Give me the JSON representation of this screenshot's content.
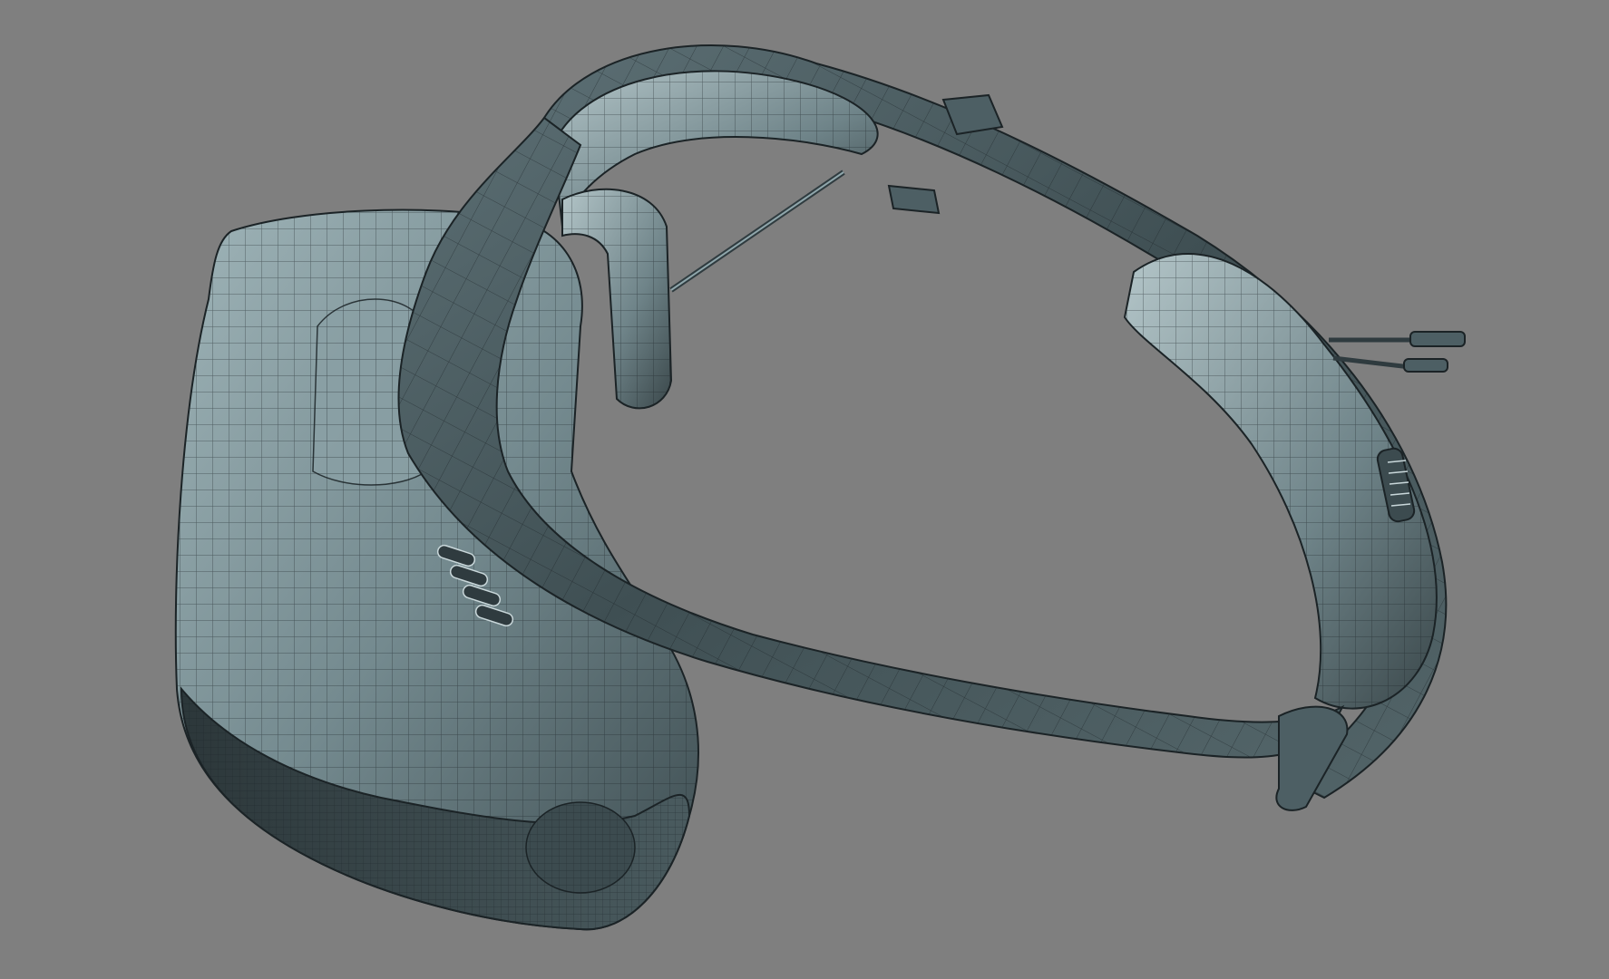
{
  "viewport": {
    "background": "#7f7f7f"
  },
  "model": {
    "subject": "vr-headset-wireframe",
    "shading": "smooth-shaded-with-wireframe",
    "colors": {
      "surface_dark": "#2f3b3f",
      "surface_mid": "#4d5f64",
      "surface_light": "#8fa6ab",
      "highlight": "#c9d7da",
      "wire": "#1b2326",
      "background": "#7f7f7f"
    }
  }
}
